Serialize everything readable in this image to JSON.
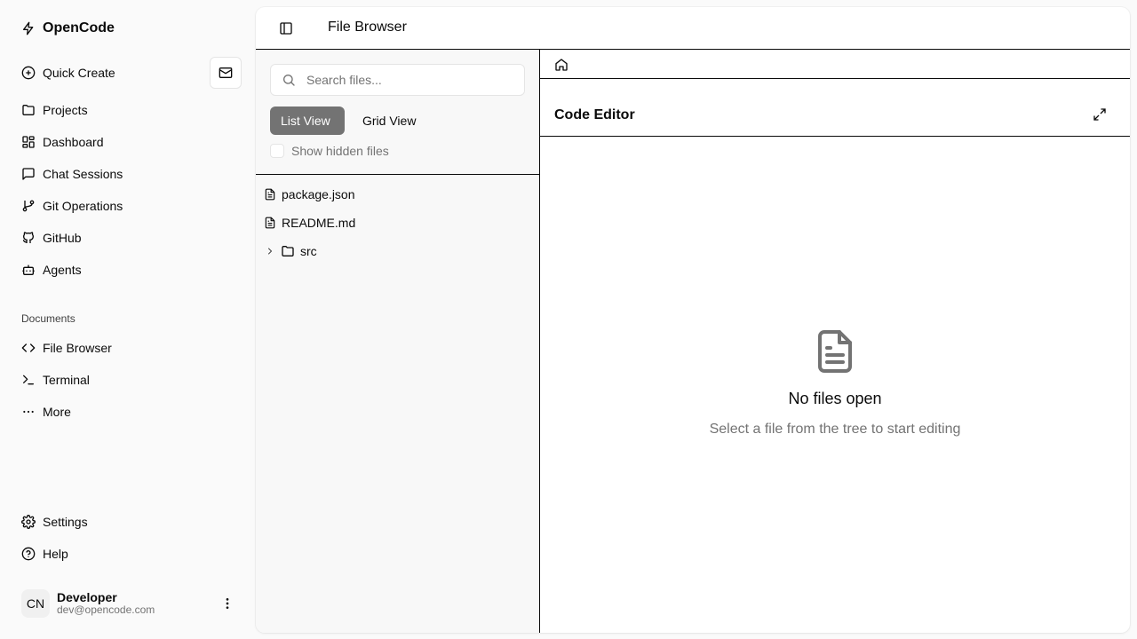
{
  "app": {
    "name": "OpenCode"
  },
  "sidebar": {
    "quick_create": "Quick Create",
    "items": [
      {
        "label": "Projects",
        "icon": "folder-icon"
      },
      {
        "label": "Dashboard",
        "icon": "dashboard-icon"
      },
      {
        "label": "Chat Sessions",
        "icon": "chat-icon"
      },
      {
        "label": "Git Operations",
        "icon": "git-branch-icon"
      },
      {
        "label": "GitHub",
        "icon": "github-icon"
      },
      {
        "label": "Agents",
        "icon": "bot-icon"
      }
    ],
    "documents_label": "Documents",
    "documents": [
      {
        "label": "File Browser",
        "icon": "code-icon"
      },
      {
        "label": "Terminal",
        "icon": "terminal-icon"
      },
      {
        "label": "More",
        "icon": "more-icon"
      }
    ],
    "footer": [
      {
        "label": "Settings",
        "icon": "gear-icon"
      },
      {
        "label": "Help",
        "icon": "help-icon"
      }
    ],
    "user": {
      "initials": "CN",
      "name": "Developer",
      "email": "dev@opencode.com"
    }
  },
  "header": {
    "title": "File Browser"
  },
  "file_browser": {
    "search_placeholder": "Search files...",
    "views": [
      "List View",
      "Grid View"
    ],
    "active_view": "List View",
    "show_hidden_label": "Show hidden files",
    "show_hidden": false,
    "files": [
      {
        "name": "package.json",
        "type": "file"
      },
      {
        "name": "README.md",
        "type": "file"
      },
      {
        "name": "src",
        "type": "folder",
        "expanded": false
      }
    ]
  },
  "editor": {
    "title": "Code Editor",
    "empty_title": "No files open",
    "empty_subtitle": "Select a file from the tree to start editing"
  }
}
